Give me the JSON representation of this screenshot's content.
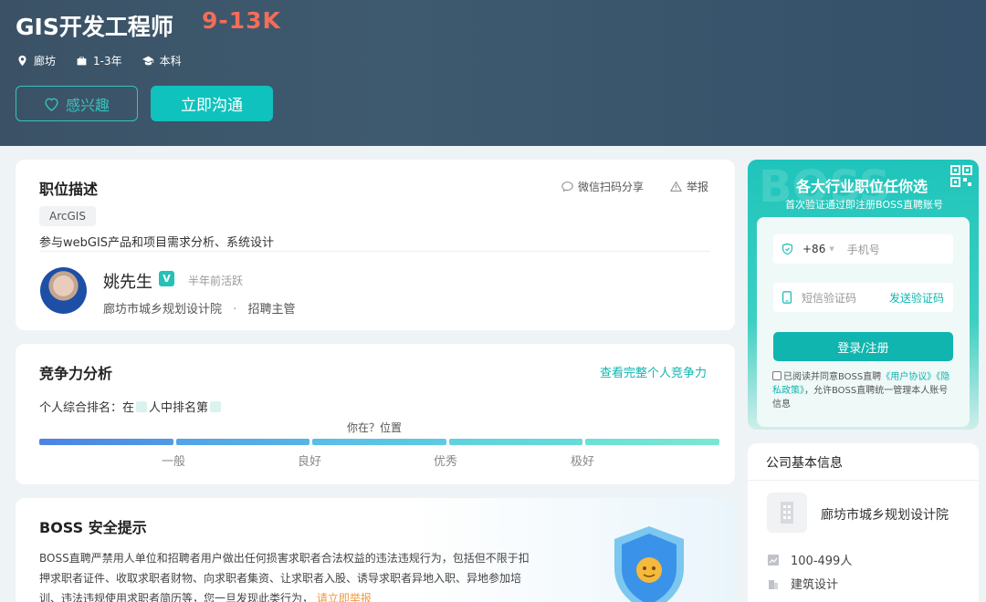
{
  "header": {
    "title": "GIS开发工程师",
    "salary": "9-13K",
    "location": "廊坊",
    "experience": "1-3年",
    "education": "本科",
    "interest_label": "感兴趣",
    "chat_label": "立即沟通"
  },
  "job": {
    "section_title": "职位描述",
    "share_label": "微信扫码分享",
    "report_label": "举报",
    "tag": "ArcGIS",
    "description": "参与webGIS产品和项目需求分析、系统设计",
    "recruiter": {
      "name": "姚先生",
      "verified_badge": "V",
      "active": "半年前活跃",
      "company": "廊坊市城乡规划设计院",
      "separator": "·",
      "role": "招聘主管"
    }
  },
  "competitiveness": {
    "section_title": "竞争力分析",
    "link": "查看完整个人竞争力",
    "rank_prefix": "个人综合排名：在",
    "rank_mid": "人中排名第",
    "position_text": "你在？位置",
    "levels": [
      "一般",
      "良好",
      "优秀",
      "极好"
    ]
  },
  "safety": {
    "section_title": "BOSS 安全提示",
    "text": "BOSS直聘严禁用人单位和招聘者用户做出任何损害求职者合法权益的违法违规行为，包括但不限于扣押求职者证件、收取求职者财物、向求职者集资、让求职者入股、诱导求职者异地入职、异地参加培训、违法违规使用求职者简历等，您一旦发现此类行为，",
    "link": "请立即举报"
  },
  "login": {
    "bg_text": "BOSS",
    "title": "各大行业职位任你选",
    "subtitle": "首次验证通过即注册BOSS直聘账号",
    "country_code": "+86",
    "phone_placeholder": "手机号",
    "code_placeholder": "短信验证码",
    "send_code": "发送验证码",
    "submit": "登录/注册",
    "agree_prefix": "已阅读并同意BOSS直聘",
    "user_agreement": "《用户协议》",
    "privacy_policy": "《隐私政策》",
    "agree_suffix": "，允许BOSS直聘统一管理本人账号信息"
  },
  "company": {
    "section_title": "公司基本信息",
    "name": "廊坊市城乡规划设计院",
    "size": "100-499人",
    "industry": "建筑设计"
  },
  "colors": {
    "accent": "#10c2bd",
    "salary": "#f26d5a",
    "header_bg": "#3b5266",
    "link": "#10b5af",
    "warning_link": "#f29a3a"
  }
}
